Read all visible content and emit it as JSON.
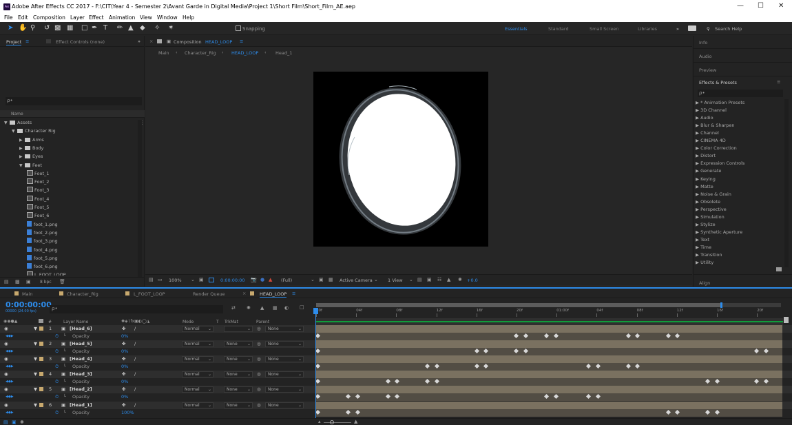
{
  "window": {
    "title": "Adobe After Effects CC 2017 - F:\\CIT\\Year 4 - Semester 2\\Avant Garde in Digital Media\\Project 1\\Short Film\\Short_Film_AE.aep",
    "app_icon": "Ae"
  },
  "menu": [
    "File",
    "Edit",
    "Composition",
    "Layer",
    "Effect",
    "Animation",
    "View",
    "Window",
    "Help"
  ],
  "toolbar": {
    "snapping": "Snapping",
    "workspaces": [
      "Essentials",
      "Standard",
      "Small Screen",
      "Libraries"
    ],
    "active_workspace": "Essentials",
    "search_help": "Search Help"
  },
  "project": {
    "tabs": [
      "Project",
      "Effect Controls (none)"
    ],
    "search_placeholder": "ρ•",
    "col_name": "Name",
    "tree": [
      {
        "label": "Assets",
        "type": "folder",
        "indent": 0
      },
      {
        "label": "Character Rig",
        "type": "folder",
        "indent": 1
      },
      {
        "label": "Arms",
        "type": "folder",
        "indent": 2
      },
      {
        "label": "Body",
        "type": "folder",
        "indent": 2
      },
      {
        "label": "Eyes",
        "type": "folder",
        "indent": 2
      },
      {
        "label": "Feet",
        "type": "folder",
        "indent": 2
      },
      {
        "label": "Foot_1",
        "type": "comp",
        "indent": 3
      },
      {
        "label": "Foot_2",
        "type": "comp",
        "indent": 3
      },
      {
        "label": "Foot_3",
        "type": "comp",
        "indent": 3
      },
      {
        "label": "Foot_4",
        "type": "comp",
        "indent": 3
      },
      {
        "label": "Foot_5",
        "type": "comp",
        "indent": 3
      },
      {
        "label": "Foot_6",
        "type": "comp",
        "indent": 3
      },
      {
        "label": "foot_1.png",
        "type": "png",
        "indent": 3
      },
      {
        "label": "foot_2.png",
        "type": "png",
        "indent": 3
      },
      {
        "label": "foot_3.png",
        "type": "png",
        "indent": 3
      },
      {
        "label": "foot_4.png",
        "type": "png",
        "indent": 3
      },
      {
        "label": "foot_5.png",
        "type": "png",
        "indent": 3
      },
      {
        "label": "foot_6.png",
        "type": "png",
        "indent": 3
      },
      {
        "label": "L_FOOT_LOOP",
        "type": "comp",
        "indent": 3
      }
    ],
    "bpc": "8 bpc"
  },
  "composition": {
    "tab_prefix": "Composition",
    "tab_name": "HEAD_LOOP",
    "breadcrumbs": [
      "Main",
      "Character_Rig",
      "HEAD_LOOP",
      "Head_1"
    ],
    "zoom": "100%",
    "timecode": "0:00:00:00",
    "resolution": "(Full)",
    "camera": "Active Camera",
    "views": "1 View",
    "exposure": "+0.0"
  },
  "right_panel": {
    "sections": [
      "Info",
      "Audio",
      "Preview",
      "Effects & Presets"
    ],
    "search_placeholder": "ρ•",
    "effects": [
      "* Animation Presets",
      "3D Channel",
      "Audio",
      "Blur & Sharpen",
      "Channel",
      "CINEMA 4D",
      "Color Correction",
      "Distort",
      "Expression Controls",
      "Generate",
      "Keying",
      "Matte",
      "Noise & Grain",
      "Obsolete",
      "Perspective",
      "Simulation",
      "Stylize",
      "Synthetic Aperture",
      "Text",
      "Time",
      "Transition",
      "Utility"
    ],
    "align": "Align"
  },
  "timeline": {
    "tabs": [
      "Main",
      "Character_Rig",
      "L_FOOT_LOOP",
      "Render Queue",
      "HEAD_LOOP"
    ],
    "active_tab": "HEAD_LOOP",
    "timecode": "0:00:00:00",
    "fps": "00000 (24.00 fps)",
    "search_placeholder": "ρ•",
    "headers": {
      "num": "#",
      "layer_name": "Layer Name",
      "mode": "Mode",
      "t": "T",
      "trkmat": "TrkMat",
      "parent": "Parent"
    },
    "ruler": [
      "00f",
      "04f",
      "08f",
      "12f",
      "16f",
      "20f",
      "01:00f",
      "04f",
      "08f",
      "12f",
      "16f",
      "20f"
    ],
    "layers": [
      {
        "num": "1",
        "name": "[Head_6]",
        "mode": "Normal",
        "trkmat": "",
        "parent": "None",
        "prop": "Opacity",
        "value": "0%",
        "keys": [
          0.0,
          0.425,
          0.445,
          0.49,
          0.51,
          0.665,
          0.685,
          0.75,
          0.77
        ]
      },
      {
        "num": "2",
        "name": "[Head_5]",
        "mode": "Normal",
        "trkmat": "None",
        "parent": "None",
        "prop": "Opacity",
        "value": "0%",
        "keys": [
          0.0,
          0.34,
          0.36,
          0.425,
          0.445,
          0.94,
          0.96
        ]
      },
      {
        "num": "3",
        "name": "[Head_4]",
        "mode": "Normal",
        "trkmat": "None",
        "parent": "None",
        "prop": "Opacity",
        "value": "0%",
        "keys": [
          0.0,
          0.235,
          0.255,
          0.34,
          0.36,
          0.58,
          0.6,
          0.665,
          0.685
        ]
      },
      {
        "num": "4",
        "name": "[Head_3]",
        "mode": "Normal",
        "trkmat": "None",
        "parent": "None",
        "prop": "Opacity",
        "value": "0%",
        "keys": [
          0.0,
          0.15,
          0.17,
          0.235,
          0.255,
          0.835,
          0.855,
          0.94,
          0.96
        ]
      },
      {
        "num": "5",
        "name": "[Head_2]",
        "mode": "Normal",
        "trkmat": "None",
        "parent": "None",
        "prop": "Opacity",
        "value": "0%",
        "keys": [
          0.0,
          0.065,
          0.085,
          0.15,
          0.17,
          0.49,
          0.51,
          0.58,
          0.6
        ]
      },
      {
        "num": "6",
        "name": "[Head_1]",
        "mode": "Normal",
        "trkmat": "None",
        "parent": "None",
        "prop": "Opacity",
        "value": "100%",
        "keys": [
          0.0,
          0.065,
          0.085,
          0.75,
          0.77,
          0.835,
          0.855
        ]
      }
    ]
  },
  "colors": {
    "accent": "#2d8ceb",
    "label_tan": "#c8a96e",
    "bar": "#7a7160"
  }
}
